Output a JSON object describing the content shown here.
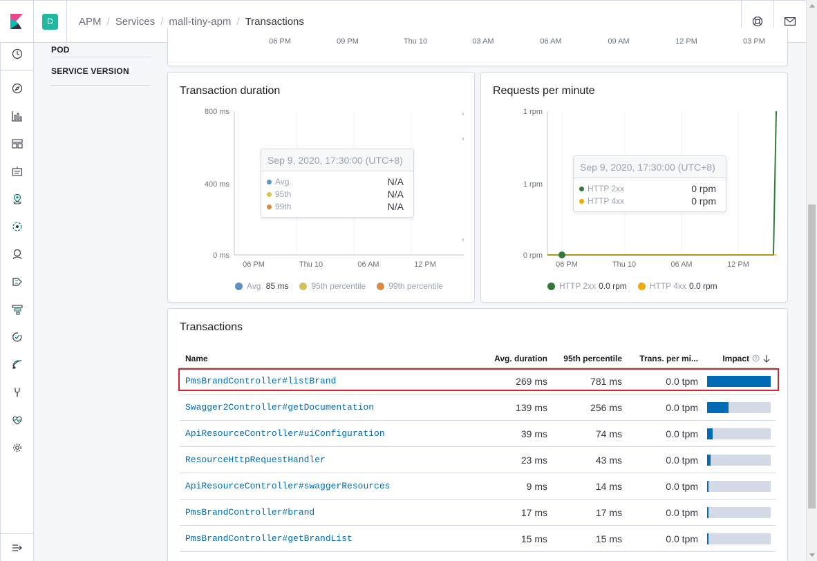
{
  "header": {
    "space_initial": "D",
    "breadcrumbs": [
      "APM",
      "Services",
      "mall-tiny-apm",
      "Transactions"
    ]
  },
  "filters": {
    "pod_label": "POD",
    "service_version_label": "SERVICE VERSION"
  },
  "top_timeline": {
    "ticks": [
      "06 PM",
      "09 PM",
      "Thu 10",
      "03 AM",
      "06 AM",
      "09 AM",
      "12 PM",
      "03 PM"
    ]
  },
  "duration_panel": {
    "title": "Transaction duration",
    "tooltip": {
      "header": "Sep 9, 2020, 17:30:00 (UTC+8)",
      "rows": [
        {
          "name": "Avg.",
          "value": "N/A",
          "color": "#6092c0"
        },
        {
          "name": "95th",
          "value": "N/A",
          "color": "#d6bf57"
        },
        {
          "name": "99th",
          "value": "N/A",
          "color": "#da8b45"
        }
      ]
    },
    "legend": [
      {
        "name": "Avg.",
        "value": "85 ms",
        "color": "#6092c0"
      },
      {
        "name": "95th percentile",
        "value": "",
        "color": "#d6bf57"
      },
      {
        "name": "99th percentile",
        "value": "",
        "color": "#da8b45"
      }
    ]
  },
  "rpm_panel": {
    "title": "Requests per minute",
    "tooltip": {
      "header": "Sep 9, 2020, 17:30:00 (UTC+8)",
      "rows": [
        {
          "name": "HTTP 2xx",
          "value": "0 rpm",
          "color": "#327a3b"
        },
        {
          "name": "HTTP 4xx",
          "value": "0 rpm",
          "color": "#f5a700"
        }
      ]
    },
    "legend": [
      {
        "name": "HTTP 2xx",
        "value": "0.0 rpm",
        "color": "#327a3b"
      },
      {
        "name": "HTTP 4xx",
        "value": "0.0 rpm",
        "color": "#f5a700"
      }
    ]
  },
  "chart_data": [
    {
      "type": "line",
      "title": "Transaction duration",
      "y_ticks": [
        "800 ms",
        "400 ms",
        "0 ms"
      ],
      "x_ticks": [
        "06 PM",
        "Thu 10",
        "06 AM",
        "12 PM"
      ],
      "ylim": [
        0,
        800
      ],
      "series": [
        {
          "name": "Avg.",
          "values": []
        },
        {
          "name": "95th percentile",
          "values": []
        },
        {
          "name": "99th percentile",
          "values": []
        }
      ]
    },
    {
      "type": "line",
      "title": "Requests per minute",
      "y_ticks": [
        "1 rpm",
        "1 rpm",
        "0 rpm"
      ],
      "x_ticks": [
        "06 PM",
        "Thu 10",
        "06 AM",
        "12 PM"
      ],
      "series": [
        {
          "name": "HTTP 2xx",
          "values": [
            0,
            0,
            0,
            0,
            1
          ]
        },
        {
          "name": "HTTP 4xx",
          "values": [
            0,
            0,
            0,
            0,
            0
          ]
        }
      ]
    }
  ],
  "transactions": {
    "title": "Transactions",
    "columns": {
      "name": "Name",
      "avg": "Avg. duration",
      "p95": "95th percentile",
      "tpm": "Trans. per mi...",
      "impact": "Impact"
    },
    "rows": [
      {
        "name": "PmsBrandController#listBrand",
        "avg": "269 ms",
        "p95": "781 ms",
        "tpm": "0.0 tpm",
        "impact": 1.0
      },
      {
        "name": "Swagger2Controller#getDocumentation",
        "avg": "139 ms",
        "p95": "256 ms",
        "tpm": "0.0 tpm",
        "impact": 0.34
      },
      {
        "name": "ApiResourceController#uiConfiguration",
        "avg": "39 ms",
        "p95": "74 ms",
        "tpm": "0.0 tpm",
        "impact": 0.09
      },
      {
        "name": "ResourceHttpRequestHandler",
        "avg": "23 ms",
        "p95": "43 ms",
        "tpm": "0.0 tpm",
        "impact": 0.055
      },
      {
        "name": "ApiResourceController#swaggerResources",
        "avg": "9 ms",
        "p95": "14 ms",
        "tpm": "0.0 tpm",
        "impact": 0.02
      },
      {
        "name": "PmsBrandController#brand",
        "avg": "17 ms",
        "p95": "17 ms",
        "tpm": "0.0 tpm",
        "impact": 0.02
      },
      {
        "name": "PmsBrandController#getBrandList",
        "avg": "15 ms",
        "p95": "15 ms",
        "tpm": "0.0 tpm",
        "impact": 0.018
      }
    ]
  }
}
